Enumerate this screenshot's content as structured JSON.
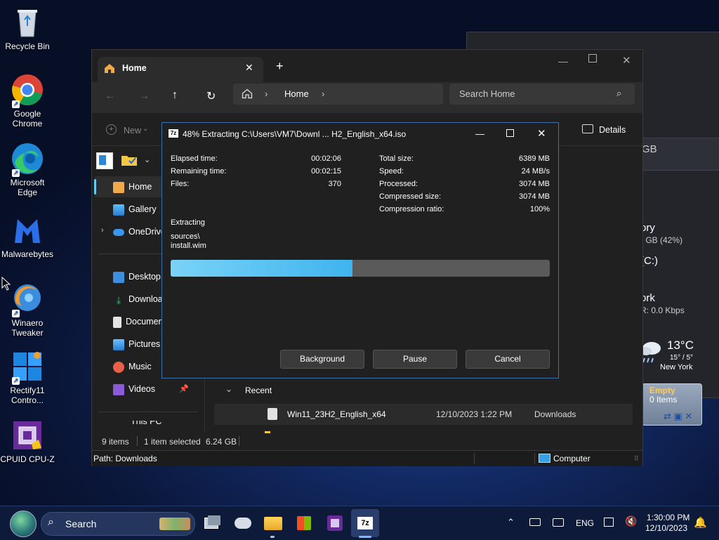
{
  "desktop": {
    "icons": [
      {
        "label": "Recycle Bin",
        "icon": "recycle-bin-icon"
      },
      {
        "label": "Google Chrome",
        "icon": "chrome-icon"
      },
      {
        "label": "Microsoft Edge",
        "icon": "edge-icon"
      },
      {
        "label": "Malwarebytes",
        "icon": "malwarebytes-icon"
      },
      {
        "label": "Winaero Tweaker",
        "icon": "winaero-icon"
      },
      {
        "label": "Rectify11 Contro...",
        "icon": "rectify11-icon"
      },
      {
        "label": "CPUID CPU-Z",
        "icon": "cpuz-icon"
      }
    ]
  },
  "gadgets": {
    "gb_text": "GB",
    "memory_title": "ory",
    "memory_value": ") GB (42%)",
    "drive_label": "(C:)",
    "network_title": "ork",
    "network_value": "R: 0.0 Kbps",
    "weather_temp": "13°C",
    "weather_range": "15° / 5°",
    "weather_city": "New York",
    "recycle_status": "Empty",
    "recycle_items": "0 Items"
  },
  "explorer": {
    "tab_title": "Home",
    "breadcrumb": "Home",
    "search_placeholder": "Search Home",
    "new_label": "New",
    "details_label": "Details",
    "nav": [
      {
        "label": "Home"
      },
      {
        "label": "Gallery"
      },
      {
        "label": "OneDrive"
      },
      {
        "label": "Desktop"
      },
      {
        "label": "Downloads"
      },
      {
        "label": "Documents"
      },
      {
        "label": "Pictures"
      },
      {
        "label": "Music"
      },
      {
        "label": "Videos"
      },
      {
        "label": "This PC"
      }
    ],
    "recent_header": "Recent",
    "recent_files": [
      {
        "name": "Win11_23H2_English_x64",
        "date": "12/10/2023 1:22 PM",
        "location": "Downloads"
      }
    ],
    "status": {
      "items": "9 items",
      "selected": "1 item selected",
      "size": "6.24 GB"
    },
    "path": "Path: Downloads",
    "computer": "Computer"
  },
  "sevenzip": {
    "title": "48% Extracting C:\\Users\\VM7\\Downl ... H2_English_x64.iso",
    "progress": 0.48,
    "left_stats": [
      {
        "label": "Elapsed time:",
        "value": "00:02:06"
      },
      {
        "label": "Remaining time:",
        "value": "00:02:15"
      },
      {
        "label": "Files:",
        "value": "370"
      }
    ],
    "right_stats": [
      {
        "label": "Total size:",
        "value": "6389 MB"
      },
      {
        "label": "Speed:",
        "value": "24 MB/s"
      },
      {
        "label": "Processed:",
        "value": "3074 MB"
      },
      {
        "label": "Compressed size:",
        "value": "3074 MB"
      },
      {
        "label": "Compression ratio:",
        "value": "100%"
      }
    ],
    "action": "Extracting",
    "path_line1": "sources\\",
    "path_line2": "install.wim",
    "buttons": {
      "background": "Background",
      "pause": "Pause",
      "cancel": "Cancel"
    }
  },
  "taskbar": {
    "search_placeholder": "Search",
    "language": "ENG",
    "time": "1:30:00 PM",
    "date": "12/10/2023"
  }
}
